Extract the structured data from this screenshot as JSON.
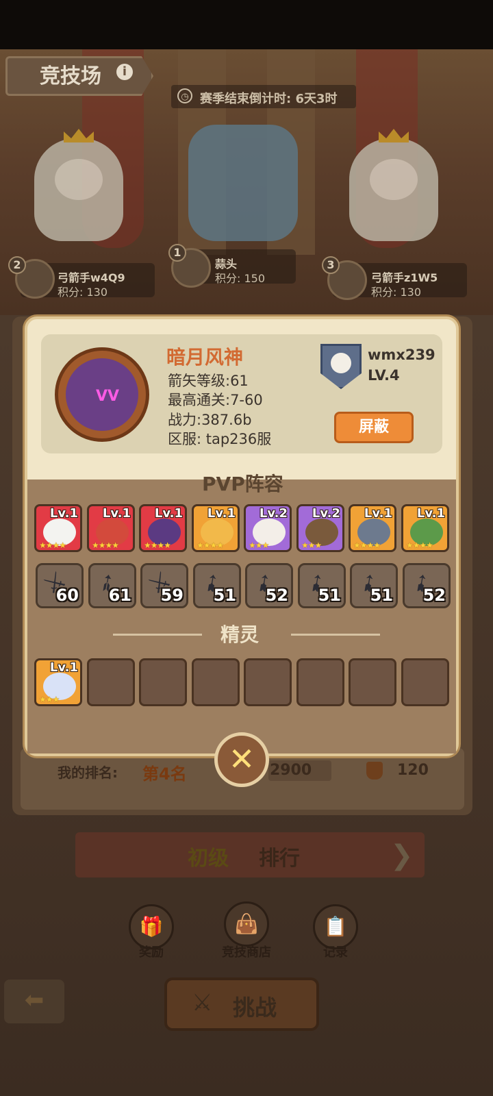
{
  "header": {
    "title": "竞技场",
    "info_icon": "i",
    "season_countdown": "赛季结束倒计时: 6天3时"
  },
  "podium": [
    {
      "rank": "2",
      "name": "弓箭手w4Q9",
      "score": "积分: 130"
    },
    {
      "rank": "1",
      "name": "蒜头",
      "score": "积分: 150"
    },
    {
      "rank": "3",
      "name": "弓箭手z1W5",
      "score": "积分: 130"
    }
  ],
  "profile": {
    "name": "暗月风神",
    "arrow_level": "箭矢等级:61",
    "best_stage": "最高通关:7-60",
    "power": "战力:387.6b",
    "server": "区服: tap236服",
    "guild_name": "wmx239",
    "guild_level": "LV.4",
    "block_label": "屏蔽",
    "avatar_eyes": "VV"
  },
  "lineup": {
    "title": "PVP阵容",
    "heroes": [
      {
        "lv": "Lv.1",
        "stars": "★★★★",
        "bg": "#e23b45",
        "body": "#f3f3f0"
      },
      {
        "lv": "Lv.1",
        "stars": "★★★★",
        "bg": "#e23b45",
        "body": "#d34a3c"
      },
      {
        "lv": "Lv.1",
        "stars": "★★★★",
        "bg": "#e23b45",
        "body": "#5b3a82"
      },
      {
        "lv": "Lv.1",
        "stars": "★★★★",
        "bg": "#f1a236",
        "body": "#f2b94a"
      },
      {
        "lv": "Lv.2",
        "stars": "★★★",
        "bg": "#a26bd8",
        "body": "#f3eee8"
      },
      {
        "lv": "Lv.2",
        "stars": "★★★",
        "bg": "#a26bd8",
        "body": "#7a5a3c"
      },
      {
        "lv": "Lv.1",
        "stars": "★★★★",
        "bg": "#f1a236",
        "body": "#6d7a8e"
      },
      {
        "lv": "Lv.1",
        "stars": "★★★★",
        "bg": "#f1a236",
        "body": "#5c9a4a"
      }
    ],
    "weapons": [
      {
        "level": "60",
        "glyph": "⚔"
      },
      {
        "level": "61",
        "glyph": "➶"
      },
      {
        "level": "59",
        "glyph": "⚔"
      },
      {
        "level": "51",
        "glyph": "➹"
      },
      {
        "level": "52",
        "glyph": "➹"
      },
      {
        "level": "51",
        "glyph": "➹"
      },
      {
        "level": "51",
        "glyph": "➹"
      },
      {
        "level": "52",
        "glyph": "➹"
      }
    ]
  },
  "spirit": {
    "title": "精灵",
    "items": [
      {
        "lv": "Lv.1",
        "stars": "★★★",
        "bg": "#f1a236",
        "body": "#d9e2f7"
      }
    ]
  },
  "close_icon": "✕",
  "my_rank": {
    "label": "我的排名:",
    "value": "第4名",
    "score": "2900",
    "cups": "120"
  },
  "tier": {
    "left": "初级",
    "right": "排行",
    "next": "❯"
  },
  "menu": [
    {
      "label": "奖励",
      "icon": "gift-icon",
      "glyph": "🎁"
    },
    {
      "label": "竞技商店",
      "icon": "shop-bag-icon",
      "glyph": "👜"
    },
    {
      "label": "记录",
      "icon": "clipboard-icon",
      "glyph": "📋"
    }
  ],
  "back_icon": "⬅",
  "challenge": {
    "label": "挑战",
    "icon": "⚔"
  }
}
